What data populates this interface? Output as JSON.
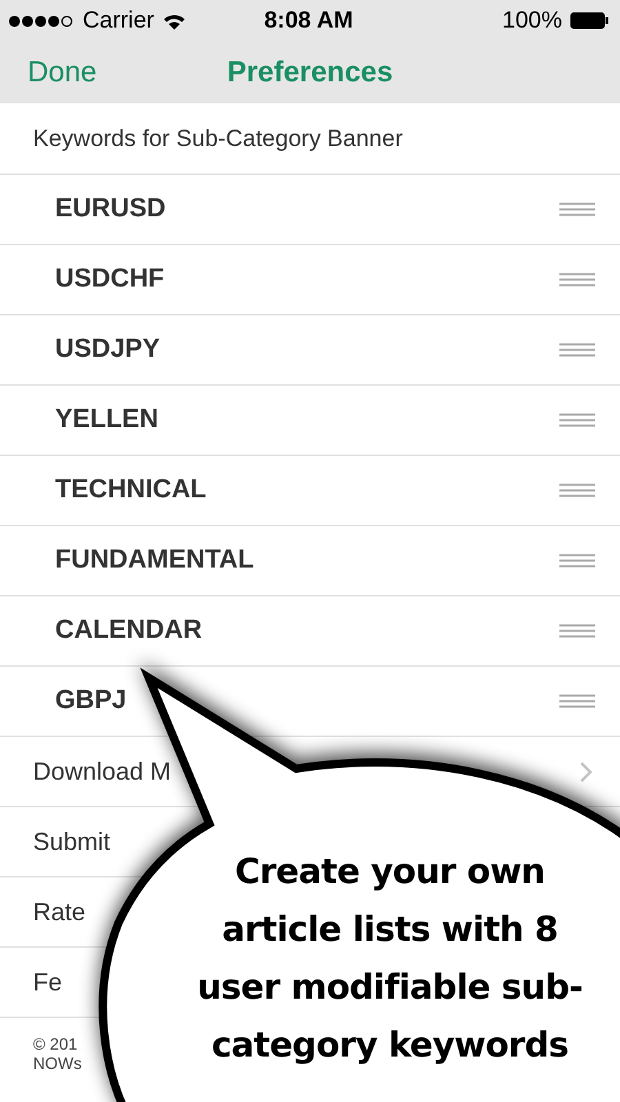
{
  "status_bar": {
    "carrier": "Carrier",
    "time": "8:08 AM",
    "battery": "100%"
  },
  "nav_bar": {
    "left_button": "Done",
    "title": "Preferences"
  },
  "section_header": "Keywords for Sub-Category Banner",
  "keywords": [
    "EURUSD",
    "USDCHF",
    "USDJPY",
    "YELLEN",
    "TECHNICAL",
    "FUNDAMENTAL",
    "CALENDAR",
    "GBPJ"
  ],
  "menu_items": [
    {
      "label": "Download M",
      "disclosure": true
    },
    {
      "label": "Submit",
      "disclosure": false
    },
    {
      "label": "Rate",
      "disclosure": false
    },
    {
      "label": "Fe",
      "disclosure": false
    }
  ],
  "footer": [
    "© 201",
    "NOWs"
  ],
  "callout": {
    "text": "Create your own article lists with 8 user modifiable sub-category keywords"
  }
}
